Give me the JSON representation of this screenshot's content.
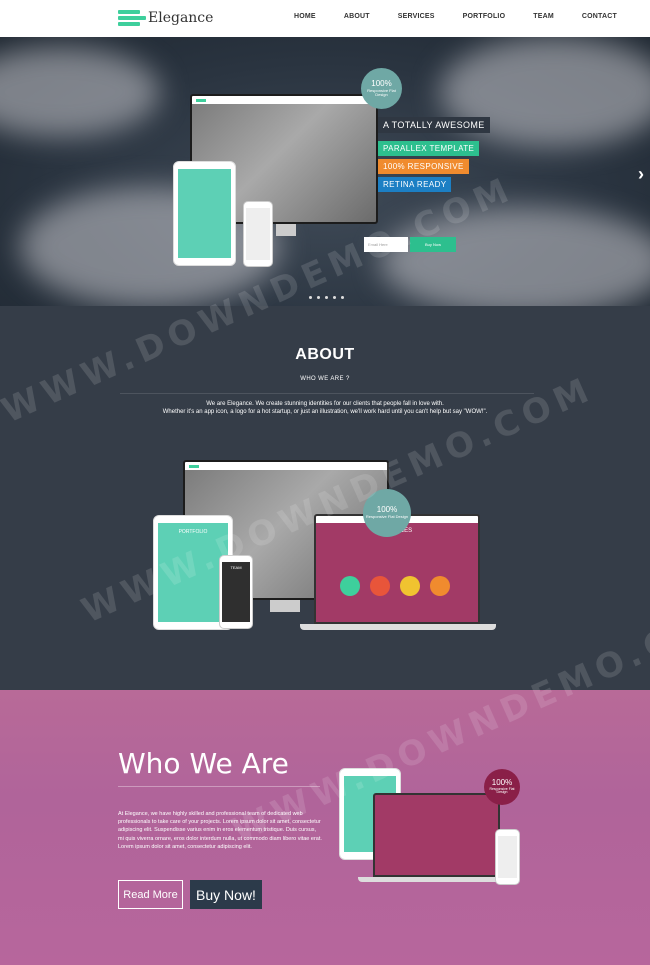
{
  "nav": {
    "logo_text": "Elegance",
    "items": [
      "HOME",
      "ABOUT",
      "SERVICES",
      "PORTFOLIO",
      "TEAM",
      "CONTACT"
    ]
  },
  "hero": {
    "badge_percent": "100%",
    "badge_text": "Responsive Flat Design",
    "tag_main": "A TOTALLY AWESOME",
    "tag_1": "PARALLEX TEMPLATE",
    "tag_2": "100% RESPONSIVE",
    "tag_3": "RETINA READY",
    "form_placeholder": "Email Here",
    "form_button": "Buy Now",
    "next_arrow": "›",
    "slide_count": 5,
    "colors": {
      "tag_main": "#2f3742",
      "tag_1": "#2dbf8e",
      "tag_2": "#f08b2e",
      "tag_3": "#1c7fc4",
      "badge": "#6fa8a5"
    }
  },
  "about": {
    "title": "ABOUT",
    "subtitle": "WHO WE ARE ?",
    "line1": "We are Elegance. We create stunning identities for our clients that people fall in love with.",
    "line2": "Whether it's an app icon, a logo for a hot startup, or just an illustration, we'll work hard until you can't help but say \"WOW!\".",
    "badge_percent": "100%",
    "badge_text": "Responsive Flat Design",
    "services_label": "SERVICES",
    "portfolio_label": "PORTFOLIO",
    "team_label": "TEAM"
  },
  "who": {
    "title": "Who We Are",
    "paragraph": "At Elegance, we have highly skilled and professional team of dedicated web professionals to take care of your projects. Lorem ipsum dolor sit amet, consectetur adipiscing elit. Suspendisse varius enim in eros elementum tristique. Duis cursus, mi quis viverra ornare, eros dolor interdum nulla, ut commodo diam libero vitae erat. Lorem ipsum dolor sit amet, consectetur adipiscing elit.",
    "read_more": "Read More",
    "buy_now": "Buy Now!",
    "badge_percent": "100%",
    "badge_text": "Responsive Flat Design"
  },
  "watermark": "WWW.DOWNDEMO.COM"
}
